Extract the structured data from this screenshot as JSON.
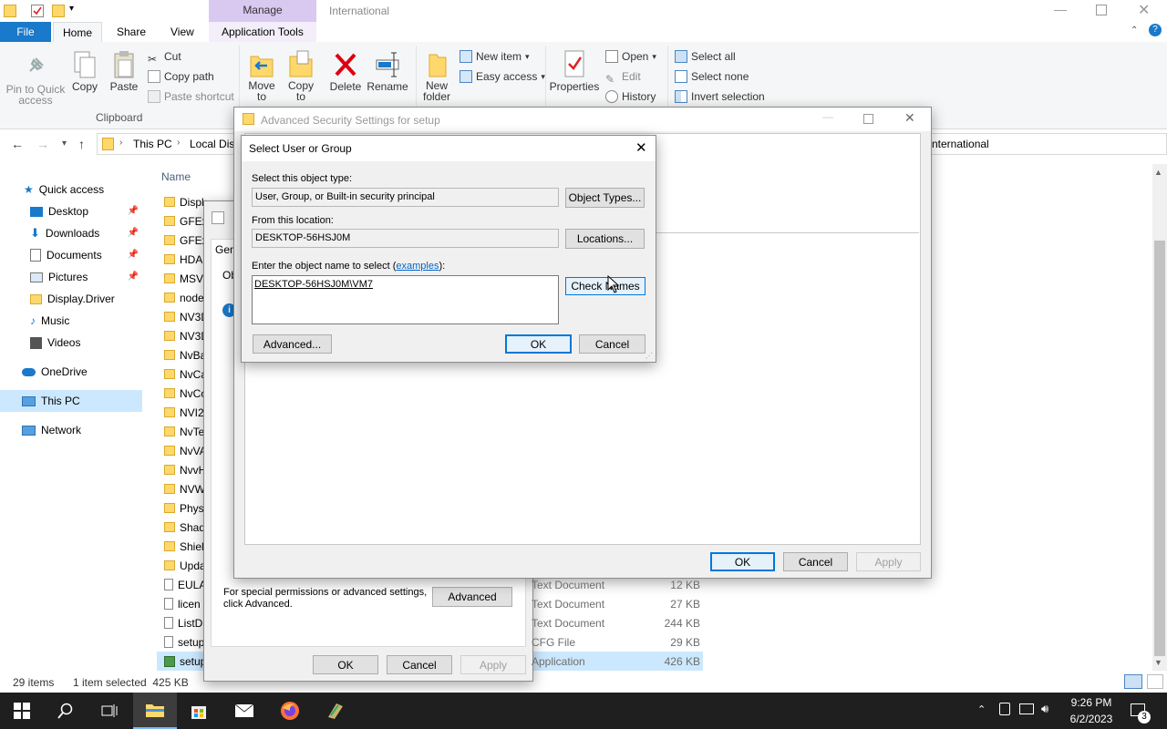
{
  "window": {
    "manage_tab": "Manage",
    "title": "International"
  },
  "ribbon": {
    "tabs": [
      "File",
      "Home",
      "Share",
      "View",
      "Application Tools"
    ],
    "clipboard": {
      "pin_label": "Pin to Quick access",
      "copy_label": "Copy",
      "paste_label": "Paste",
      "cut_label": "Cut",
      "copy_path_label": "Copy path",
      "paste_shortcut_label": "Paste shortcut",
      "group_label": "Clipboard"
    },
    "organize": {
      "move_to": "Move to",
      "copy_to": "Copy to",
      "delete": "Delete",
      "rename": "Rename"
    },
    "new": {
      "new_folder": "New folder",
      "new_item": "New item",
      "easy_access": "Easy access"
    },
    "open": {
      "properties": "Properties",
      "open": "Open",
      "edit": "Edit",
      "history": "History"
    },
    "select": {
      "select_all": "Select all",
      "select_none": "Select none",
      "invert_selection": "Invert selection"
    }
  },
  "address": {
    "crumbs": [
      "This PC",
      "Local Disk"
    ],
    "right_text": "nternational"
  },
  "nav": {
    "items": [
      {
        "label": "Quick access",
        "icon": "star-icon"
      },
      {
        "label": "Desktop",
        "icon": "desktop-icon"
      },
      {
        "label": "Downloads",
        "icon": "download-icon"
      },
      {
        "label": "Documents",
        "icon": "documents-icon"
      },
      {
        "label": "Pictures",
        "icon": "pictures-icon"
      },
      {
        "label": "Display.Driver",
        "icon": "folder-icon"
      },
      {
        "label": "Music",
        "icon": "music-icon"
      },
      {
        "label": "Videos",
        "icon": "videos-icon"
      },
      {
        "label": "OneDrive",
        "icon": "cloud-icon"
      },
      {
        "label": "This PC",
        "icon": "pc-icon"
      },
      {
        "label": "Network",
        "icon": "network-icon"
      }
    ]
  },
  "files": {
    "column_name": "Name",
    "rows": [
      "DisplayDriv",
      "GFEx",
      "GFEx",
      "HDA",
      "MSV",
      "node",
      "NV3D",
      "NV3D",
      "NvBa",
      "NvCa",
      "NvCo",
      "NVI2",
      "NvTe",
      "NvVA",
      "NvvH",
      "NVW",
      "Phys",
      "Shad",
      "Shiel",
      "Upda",
      "EULA",
      "licen",
      "ListD",
      "setup",
      "setup"
    ],
    "details": [
      {
        "type": "Text Document",
        "size": "12 KB"
      },
      {
        "type": "Text Document",
        "size": "27 KB"
      },
      {
        "type": "Text Document",
        "size": "244 KB"
      },
      {
        "type": "CFG File",
        "size": "29 KB"
      },
      {
        "type": "Application",
        "size": "426 KB"
      }
    ]
  },
  "status": {
    "items": "29 items",
    "selected": "1 item selected  425 KB"
  },
  "props_dialog": {
    "tab": "Gen",
    "ob": "Ob",
    "special_text_1": "For special permissions or advanced settings,",
    "special_text_2": "click Advanced.",
    "advanced": "Advanced",
    "ok": "OK",
    "cancel": "Cancel",
    "apply": "Apply"
  },
  "adv_dialog": {
    "title": "Advanced Security Settings for setup",
    "ok": "OK",
    "cancel": "Cancel",
    "apply": "Apply"
  },
  "select_dialog": {
    "title": "Select User or Group",
    "object_type_label": "Select this object type:",
    "object_type_value": "User, Group, or Built-in security principal",
    "object_types_btn": "Object Types...",
    "location_label": "From this location:",
    "location_value": "DESKTOP-56HSJ0M",
    "locations_btn": "Locations...",
    "enter_label_pre": "Enter the object name to select (",
    "enter_label_link": "examples",
    "enter_label_post": "):",
    "object_name": "DESKTOP-56HSJ0M\\VM7",
    "check_names_btn": "Check Names",
    "advanced_btn": "Advanced...",
    "ok": "OK",
    "cancel": "Cancel"
  },
  "taskbar": {
    "time": "9:26 PM",
    "date": "6/2/2023",
    "notifications": "3"
  }
}
